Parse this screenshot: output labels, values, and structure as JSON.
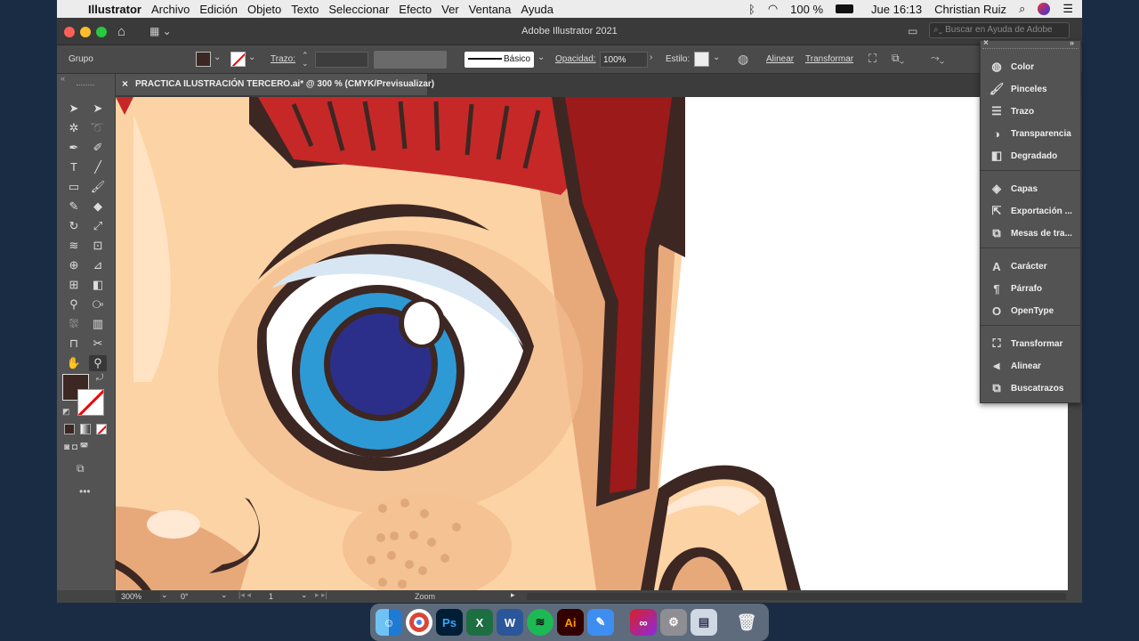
{
  "menubar": {
    "apple": "",
    "app": "Illustrator",
    "items": [
      "Archivo",
      "Edición",
      "Objeto",
      "Texto",
      "Seleccionar",
      "Efecto",
      "Ver",
      "Ventana",
      "Ayuda"
    ],
    "battery": "100 %",
    "clock": "Jue 16:13",
    "user": "Christian Ruiz"
  },
  "window": {
    "title": "Adobe Illustrator 2021",
    "search_placeholder": "Buscar en Ayuda de Adobe"
  },
  "control_bar": {
    "selection": "Grupo",
    "stroke_label": "Trazo:",
    "brush_label": "Básico",
    "opacity_label": "Opacidad:",
    "opacity_value": "100%",
    "style_label": "Estilo:",
    "align_label": "Alinear",
    "transform_label": "Transformar",
    "fill_color": "#3d2723"
  },
  "document": {
    "tab_title": "PRACTICA ILUSTRACIÓN TERCERO.ai* @ 300 % (CMYK/Previsualizar)",
    "close_glyph": "×"
  },
  "status": {
    "zoom": "300%",
    "rotation": "0°",
    "artboard": "1",
    "tool_name": "Zoom"
  },
  "panels": {
    "group1": [
      {
        "label": "Color",
        "icon": "color-icon"
      },
      {
        "label": "Pinceles",
        "icon": "brushes-icon"
      },
      {
        "label": "Trazo",
        "icon": "stroke-icon"
      },
      {
        "label": "Transparencia",
        "icon": "transparency-icon"
      },
      {
        "label": "Degradado",
        "icon": "gradient-icon"
      }
    ],
    "group2": [
      {
        "label": "Capas",
        "icon": "layers-icon"
      },
      {
        "label": "Exportación ...",
        "icon": "export-icon"
      },
      {
        "label": "Mesas de tra...",
        "icon": "artboards-icon"
      }
    ],
    "group3": [
      {
        "label": "Carácter",
        "icon": "character-icon"
      },
      {
        "label": "Párrafo",
        "icon": "paragraph-icon"
      },
      {
        "label": "OpenType",
        "icon": "opentype-icon"
      }
    ],
    "group4": [
      {
        "label": "Transformar",
        "icon": "transform-icon"
      },
      {
        "label": "Alinear",
        "icon": "align-icon"
      },
      {
        "label": "Buscatrazos",
        "icon": "pathfinder-icon"
      }
    ]
  },
  "dock": {
    "apps": [
      "Finder",
      "Chrome",
      "Photoshop",
      "Excel",
      "Word",
      "Spotify",
      "Illustrator",
      "Notas",
      "Creative Cloud",
      "Preferencias",
      "Vista Previa",
      "Papelera"
    ],
    "ps_label": "Ps",
    "ai_label": "Ai"
  },
  "colors": {
    "skin": "#fcd3a5",
    "skin_shadow": "#e8b287",
    "outline": "#3d2723",
    "hair": "#c62828",
    "hair_dark": "#9c1a1a",
    "iris": "#2d9ad6",
    "pupil": "#2c2f8a"
  }
}
